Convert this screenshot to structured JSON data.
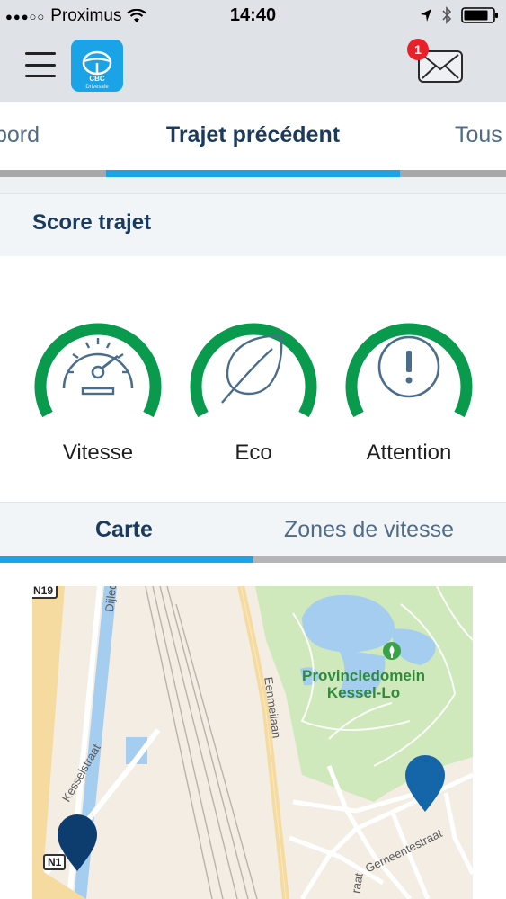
{
  "status_bar": {
    "carrier": "Proximus",
    "time": "14:40"
  },
  "header": {
    "logo_brand": "CBC",
    "logo_sub": "Drivesafe",
    "notification_count": "1"
  },
  "top_tabs": {
    "left": "bord",
    "active": "Trajet précédent",
    "right": "Tous"
  },
  "section": {
    "title": "Score trajet"
  },
  "gauges": [
    {
      "label": "Vitesse",
      "icon": "speedometer-icon"
    },
    {
      "label": "Eco",
      "icon": "leaf-icon"
    },
    {
      "label": "Attention",
      "icon": "exclamation-icon"
    }
  ],
  "sub_tabs": {
    "map": "Carte",
    "speed_zones": "Zones de vitesse"
  },
  "map": {
    "road_top_left": "N19",
    "road_bottom_left": "N1",
    "street_dijle": "Dijledre",
    "street_kessel": "Kesselstraat",
    "street_eenmeilaan": "Eenmeilaan",
    "street_gemeente": "Gemeentestraat",
    "street_bottom": "raat",
    "park_line1": "Provinciedomein",
    "park_line2": "Kessel-Lo"
  },
  "colors": {
    "accent_blue": "#1aa3e6",
    "navy": "#1b3a5c",
    "gauge_green": "#0a9a4e",
    "badge_red": "#e8202a",
    "pin_dark": "#0d3d6e",
    "pin_blue": "#1566a8"
  }
}
